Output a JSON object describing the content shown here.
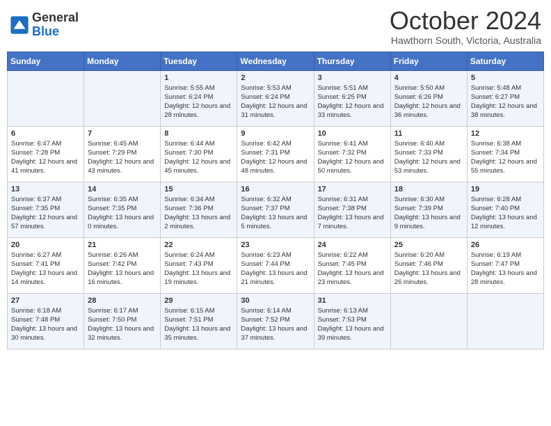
{
  "header": {
    "logo_general": "General",
    "logo_blue": "Blue",
    "month_title": "October 2024",
    "subtitle": "Hawthorn South, Victoria, Australia"
  },
  "weekdays": [
    "Sunday",
    "Monday",
    "Tuesday",
    "Wednesday",
    "Thursday",
    "Friday",
    "Saturday"
  ],
  "weeks": [
    [
      {
        "day": "",
        "sunrise": "",
        "sunset": "",
        "daylight": ""
      },
      {
        "day": "",
        "sunrise": "",
        "sunset": "",
        "daylight": ""
      },
      {
        "day": "1",
        "sunrise": "Sunrise: 5:55 AM",
        "sunset": "Sunset: 6:24 PM",
        "daylight": "Daylight: 12 hours and 28 minutes."
      },
      {
        "day": "2",
        "sunrise": "Sunrise: 5:53 AM",
        "sunset": "Sunset: 6:24 PM",
        "daylight": "Daylight: 12 hours and 31 minutes."
      },
      {
        "day": "3",
        "sunrise": "Sunrise: 5:51 AM",
        "sunset": "Sunset: 6:25 PM",
        "daylight": "Daylight: 12 hours and 33 minutes."
      },
      {
        "day": "4",
        "sunrise": "Sunrise: 5:50 AM",
        "sunset": "Sunset: 6:26 PM",
        "daylight": "Daylight: 12 hours and 36 minutes."
      },
      {
        "day": "5",
        "sunrise": "Sunrise: 5:48 AM",
        "sunset": "Sunset: 6:27 PM",
        "daylight": "Daylight: 12 hours and 38 minutes."
      }
    ],
    [
      {
        "day": "6",
        "sunrise": "Sunrise: 6:47 AM",
        "sunset": "Sunset: 7:28 PM",
        "daylight": "Daylight: 12 hours and 41 minutes."
      },
      {
        "day": "7",
        "sunrise": "Sunrise: 6:45 AM",
        "sunset": "Sunset: 7:29 PM",
        "daylight": "Daylight: 12 hours and 43 minutes."
      },
      {
        "day": "8",
        "sunrise": "Sunrise: 6:44 AM",
        "sunset": "Sunset: 7:30 PM",
        "daylight": "Daylight: 12 hours and 45 minutes."
      },
      {
        "day": "9",
        "sunrise": "Sunrise: 6:42 AM",
        "sunset": "Sunset: 7:31 PM",
        "daylight": "Daylight: 12 hours and 48 minutes."
      },
      {
        "day": "10",
        "sunrise": "Sunrise: 6:41 AM",
        "sunset": "Sunset: 7:32 PM",
        "daylight": "Daylight: 12 hours and 50 minutes."
      },
      {
        "day": "11",
        "sunrise": "Sunrise: 6:40 AM",
        "sunset": "Sunset: 7:33 PM",
        "daylight": "Daylight: 12 hours and 53 minutes."
      },
      {
        "day": "12",
        "sunrise": "Sunrise: 6:38 AM",
        "sunset": "Sunset: 7:34 PM",
        "daylight": "Daylight: 12 hours and 55 minutes."
      }
    ],
    [
      {
        "day": "13",
        "sunrise": "Sunrise: 6:37 AM",
        "sunset": "Sunset: 7:35 PM",
        "daylight": "Daylight: 12 hours and 57 minutes."
      },
      {
        "day": "14",
        "sunrise": "Sunrise: 6:35 AM",
        "sunset": "Sunset: 7:35 PM",
        "daylight": "Daylight: 13 hours and 0 minutes."
      },
      {
        "day": "15",
        "sunrise": "Sunrise: 6:34 AM",
        "sunset": "Sunset: 7:36 PM",
        "daylight": "Daylight: 13 hours and 2 minutes."
      },
      {
        "day": "16",
        "sunrise": "Sunrise: 6:32 AM",
        "sunset": "Sunset: 7:37 PM",
        "daylight": "Daylight: 13 hours and 5 minutes."
      },
      {
        "day": "17",
        "sunrise": "Sunrise: 6:31 AM",
        "sunset": "Sunset: 7:38 PM",
        "daylight": "Daylight: 13 hours and 7 minutes."
      },
      {
        "day": "18",
        "sunrise": "Sunrise: 6:30 AM",
        "sunset": "Sunset: 7:39 PM",
        "daylight": "Daylight: 13 hours and 9 minutes."
      },
      {
        "day": "19",
        "sunrise": "Sunrise: 6:28 AM",
        "sunset": "Sunset: 7:40 PM",
        "daylight": "Daylight: 13 hours and 12 minutes."
      }
    ],
    [
      {
        "day": "20",
        "sunrise": "Sunrise: 6:27 AM",
        "sunset": "Sunset: 7:41 PM",
        "daylight": "Daylight: 13 hours and 14 minutes."
      },
      {
        "day": "21",
        "sunrise": "Sunrise: 6:26 AM",
        "sunset": "Sunset: 7:42 PM",
        "daylight": "Daylight: 13 hours and 16 minutes."
      },
      {
        "day": "22",
        "sunrise": "Sunrise: 6:24 AM",
        "sunset": "Sunset: 7:43 PM",
        "daylight": "Daylight: 13 hours and 19 minutes."
      },
      {
        "day": "23",
        "sunrise": "Sunrise: 6:23 AM",
        "sunset": "Sunset: 7:44 PM",
        "daylight": "Daylight: 13 hours and 21 minutes."
      },
      {
        "day": "24",
        "sunrise": "Sunrise: 6:22 AM",
        "sunset": "Sunset: 7:45 PM",
        "daylight": "Daylight: 13 hours and 23 minutes."
      },
      {
        "day": "25",
        "sunrise": "Sunrise: 6:20 AM",
        "sunset": "Sunset: 7:46 PM",
        "daylight": "Daylight: 13 hours and 26 minutes."
      },
      {
        "day": "26",
        "sunrise": "Sunrise: 6:19 AM",
        "sunset": "Sunset: 7:47 PM",
        "daylight": "Daylight: 13 hours and 28 minutes."
      }
    ],
    [
      {
        "day": "27",
        "sunrise": "Sunrise: 6:18 AM",
        "sunset": "Sunset: 7:48 PM",
        "daylight": "Daylight: 13 hours and 30 minutes."
      },
      {
        "day": "28",
        "sunrise": "Sunrise: 6:17 AM",
        "sunset": "Sunset: 7:50 PM",
        "daylight": "Daylight: 13 hours and 32 minutes."
      },
      {
        "day": "29",
        "sunrise": "Sunrise: 6:15 AM",
        "sunset": "Sunset: 7:51 PM",
        "daylight": "Daylight: 13 hours and 35 minutes."
      },
      {
        "day": "30",
        "sunrise": "Sunrise: 6:14 AM",
        "sunset": "Sunset: 7:52 PM",
        "daylight": "Daylight: 13 hours and 37 minutes."
      },
      {
        "day": "31",
        "sunrise": "Sunrise: 6:13 AM",
        "sunset": "Sunset: 7:53 PM",
        "daylight": "Daylight: 13 hours and 39 minutes."
      },
      {
        "day": "",
        "sunrise": "",
        "sunset": "",
        "daylight": ""
      },
      {
        "day": "",
        "sunrise": "",
        "sunset": "",
        "daylight": ""
      }
    ]
  ]
}
